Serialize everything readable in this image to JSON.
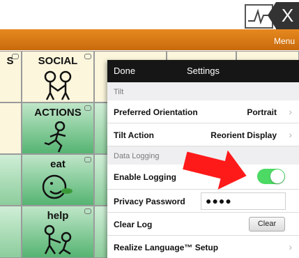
{
  "window": {
    "close_glyph": "X",
    "menu_label": "Menu"
  },
  "grid": {
    "cells": [
      {
        "label": "S"
      },
      {
        "label": "SOCIAL"
      },
      {
        "label": "ACTIONS"
      },
      {
        "label": "eat"
      },
      {
        "label": "help"
      }
    ]
  },
  "settings": {
    "done_label": "Done",
    "title": "Settings",
    "sections": [
      {
        "header": "Tilt"
      },
      {
        "header": "Data Logging"
      }
    ],
    "rows": {
      "preferred_orientation": {
        "label": "Preferred Orientation",
        "value": "Portrait"
      },
      "tilt_action": {
        "label": "Tilt Action",
        "value": "Reorient Display"
      },
      "enable_logging": {
        "label": "Enable Logging",
        "enabled": true
      },
      "privacy_password": {
        "label": "Privacy Password",
        "value": "●●●●"
      },
      "clear_log": {
        "label": "Clear Log",
        "button": "Clear"
      },
      "realize_language": {
        "label": "Realize Language™ Setup"
      }
    }
  },
  "colors": {
    "accent_orange": "#d9791a",
    "toggle_on": "#4cd964",
    "arrow_red": "#ff1a1a"
  }
}
